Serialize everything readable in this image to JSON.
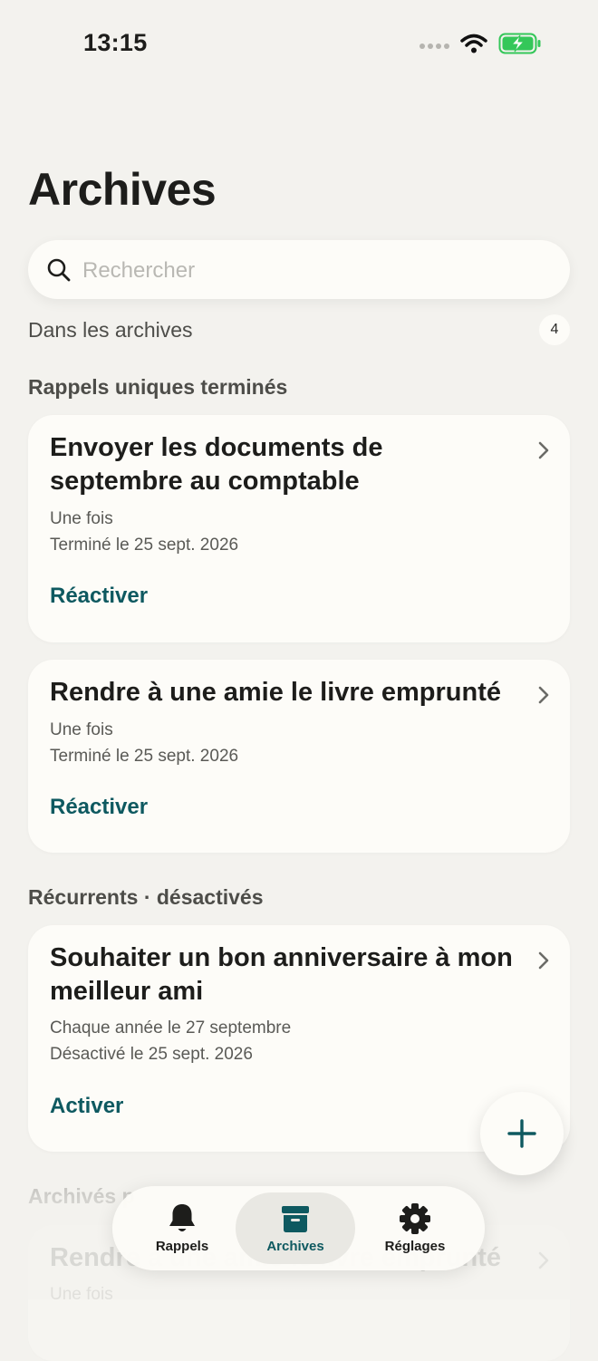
{
  "status_bar": {
    "time": "13:15"
  },
  "page": {
    "title": "Archives"
  },
  "search": {
    "placeholder": "Rechercher"
  },
  "summary": {
    "label": "Dans les archives",
    "count": "4"
  },
  "sections": [
    {
      "header": "Rappels uniques terminés",
      "cards": [
        {
          "title": "Envoyer les documents de septembre au comptable",
          "frequency": "Une fois",
          "status": "Terminé le 25 sept. 2026",
          "action": "Réactiver"
        },
        {
          "title": "Rendre à une amie le livre emprunté",
          "frequency": "Une fois",
          "status": "Terminé le 25 sept. 2026",
          "action": "Réactiver"
        }
      ]
    },
    {
      "header": "Récurrents · désactivés",
      "cards": [
        {
          "title": "Souhaiter un bon anniversaire à mon meilleur ami",
          "frequency": "Chaque année le 27 septembre",
          "status": "Désactivé le 25 sept. 2026",
          "action": "Activer"
        }
      ]
    },
    {
      "header": "Archivés p",
      "cards": [
        {
          "title": "Rendre à une amie le livre emprunté",
          "frequency": "Une fois"
        }
      ]
    }
  ],
  "tab_bar": {
    "tabs": [
      {
        "label": "Rappels",
        "icon": "bell-icon",
        "active": false
      },
      {
        "label": "Archives",
        "icon": "archive-box-icon",
        "active": true
      },
      {
        "label": "Réglages",
        "icon": "gear-icon",
        "active": false
      }
    ]
  },
  "colors": {
    "background": "#F3F2EE",
    "card": "#FDFCF8",
    "accent": "#0E5960",
    "battery_green": "#34C759"
  }
}
